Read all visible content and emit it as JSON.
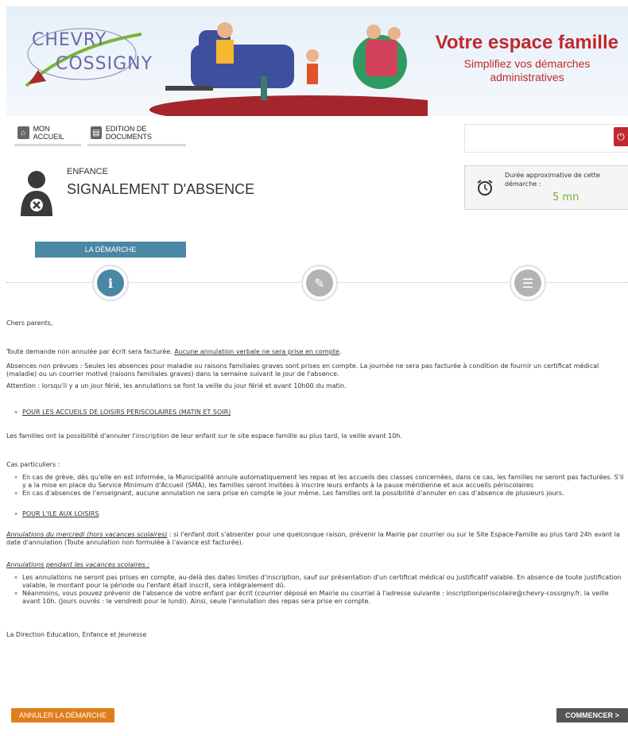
{
  "header": {
    "logo_line1": "CHEVRY",
    "logo_line2": "COSSIGNY",
    "title": "Votre espace famille",
    "subtitle": "Simplifiez vos démarches administratives"
  },
  "nav": {
    "home_label": "MON ACCUEIL",
    "documents_label": "EDITION DE DOCUMENTS"
  },
  "page": {
    "category": "ENFANCE",
    "title": "SIGNALEMENT D'ABSENCE",
    "duration_label": "Durée approximative de cette démarche :",
    "duration_value": "5 mn"
  },
  "tabs": {
    "demarche": "LA DÉMARCHE"
  },
  "steps": [
    "i",
    "✎",
    "☰"
  ],
  "content": {
    "greeting": "Chers parents,",
    "p1_text": "Toute demande non annulée par écrit sera facturée. ",
    "p1_underline": "Aucune annulation verbale ne sera prise en compte",
    "p1_end": ".",
    "p2": "Absences non prévues : Seules les absences pour maladie ou raisons familiales graves sont prises en compte. La journée ne sera pas facturée à condition de fournir un certificat médical (maladie) ou un courrier motivé (raisons familiales graves) dans la semaine suivant le jour de l'absence.",
    "p3": "Attention : lorsqu'il y a un jour férié, les annulations se font la veille du jour férié et avant 10h00 du matin.",
    "section1": "POUR LES ACCUEILS DE LOISIRS PERISCOLAIRES (MATIN ET SOIR)",
    "p4": "Les familles ont la possibilité d'annuler l'inscription de leur enfant sur le site espace famille au plus tard, la veille avant 10h.",
    "cases_title": "Cas particuliers :",
    "case1": "En cas de grève, dès qu'elle en est informée, la Municipalité annule automatiquement les repas et les accueils des classes concernées, dans ce cas, les familles ne seront pas facturées. S'il y a la mise en place du Service Minimum d'Accueil (SMA), les familles seront invitées à inscrire leurs enfants à la pause méridienne et aux accueils périscolaires",
    "case2": "En cas d'absences de l'enseignant, aucune annulation ne sera prise en compte le jour même. Les familles ont la possibilité d'annuler en cas d'absence de plusieurs jours.",
    "section2": "POUR L'ILE AUX LOISIRS",
    "wed_title": "Annulations du mercredi (hors vacances scolaires)",
    "wed_text": " : si l'enfant doit s'absenter pour une quelconque raison, prévenir la Mairie par courrier ou sur le Site Espace-Famille au plus tard 24h avant la date d'annulation (Toute annulation non formulée à l'avance est facturée).",
    "hol_title": "Annulations pendant les vacances scolaires :",
    "hol1": "Les annulations ne seront pas prises en compte, au-delà des dates limites d'inscription, sauf sur présentation d'un certificat médical ou justificatif valable. En absence de toute justification valable, le montant pour la période ou l'enfant était inscrit, sera intégralement dû.",
    "hol2": "Néanmoins, vous pouvez prévenir de l'absence de votre enfant par écrit (courrier déposé en Mairie ou courriel à l'adresse suivante : inscriptionperiscolaire@chevry-cossigny.fr, la veille avant 10h. (Jours ouvrés : le vendredi pour le lundi). Ainsi, seule l'annulation des repas sera prise en compte.",
    "signature": "La Direction Education, Enfance et Jeunesse"
  },
  "buttons": {
    "cancel": "ANNULER LA DÉMARCHE",
    "start": "COMMENCER >"
  },
  "icons": {
    "home": "home-icon",
    "documents": "printer-icon",
    "power": "power-icon",
    "clock": "alarm-clock-icon",
    "avatar": "child-absence-icon"
  },
  "colors": {
    "brand_red": "#c0292f",
    "step_blue": "#4a87a4",
    "duration_green": "#7ab030",
    "cancel_orange": "#e07e1a",
    "start_dark": "#555555"
  }
}
